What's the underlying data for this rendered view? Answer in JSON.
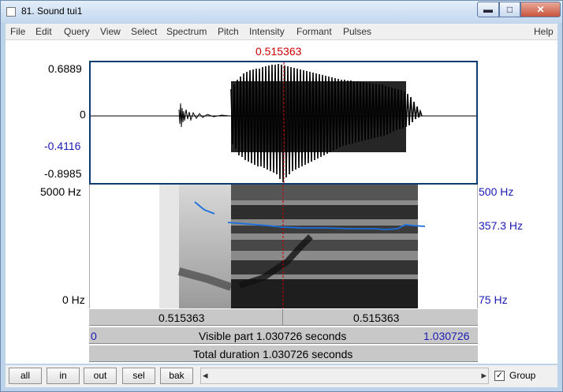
{
  "window": {
    "title": "81. Sound tui1",
    "minimize_glyph": "▬",
    "maximize_glyph": "□",
    "close_glyph": "✕"
  },
  "menu": [
    "File",
    "Edit",
    "Query",
    "View",
    "Select",
    "Spectrum",
    "Pitch",
    "Intensity",
    "Formant",
    "Pulses",
    "Help"
  ],
  "cursor": {
    "time": "0.515363",
    "color": "#cc0000"
  },
  "waveform": {
    "max": "0.6889",
    "zero": "0",
    "cursor_value": "-0.4116",
    "min": "-0.8985"
  },
  "spectrogram": {
    "freq_max": "5000 Hz",
    "freq_min": "0 Hz",
    "pitch_max": "500 Hz",
    "pitch_at_cursor": "357.3 Hz",
    "pitch_min": "75 Hz",
    "pitch_color": "#1a6fe0"
  },
  "selection": {
    "left_duration": "0.515363",
    "right_duration": "0.515363"
  },
  "visible": {
    "start": "0",
    "label": "Visible part 1.030726 seconds",
    "end": "1.030726"
  },
  "total": {
    "label": "Total duration 1.030726 seconds"
  },
  "buttons": {
    "all": "all",
    "in": "in",
    "out": "out",
    "sel": "sel",
    "bak": "bak"
  },
  "scroll": {
    "left_arrow": "◂",
    "right_arrow": "▸"
  },
  "group": {
    "label": "Group",
    "checked": true,
    "check_glyph": "✓"
  }
}
